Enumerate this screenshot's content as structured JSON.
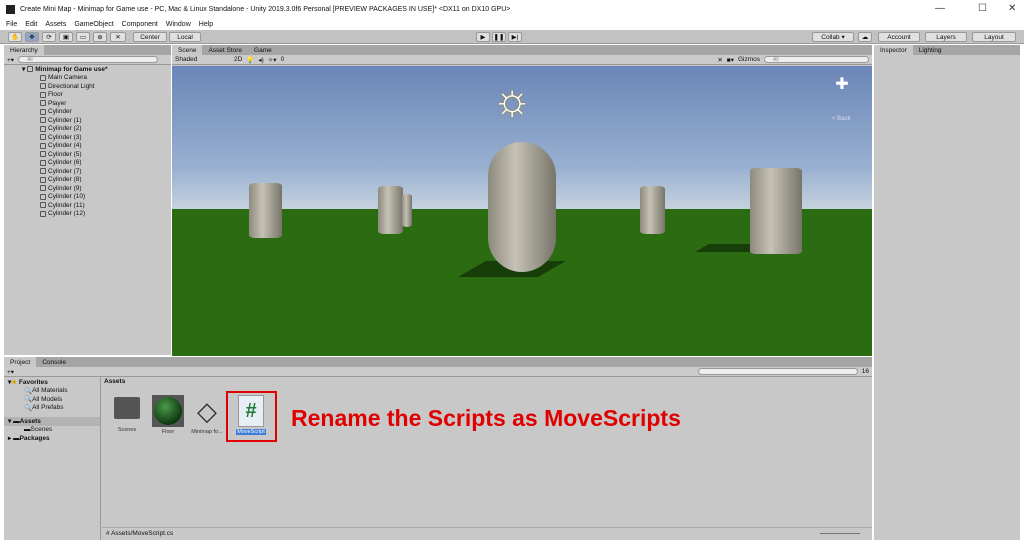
{
  "window": {
    "title": "Create Mini Map - Minimap for Game use - PC, Mac & Linux Standalone - Unity 2019.3.0f6 Personal [PREVIEW PACKAGES IN USE]* <DX11 on DX10 GPU>"
  },
  "menu": [
    "File",
    "Edit",
    "Assets",
    "GameObject",
    "Component",
    "Window",
    "Help"
  ],
  "toolbar": {
    "center": "Center",
    "local": "Local",
    "collab": "Collab ▾",
    "account": "Account",
    "layers": "Layers",
    "layout": "Layout"
  },
  "hierarchy": {
    "tab": "Hierarchy",
    "search": "All",
    "scene": "Minimap for Game use*",
    "items": [
      "Main Camera",
      "Directional Light",
      "Floor",
      "Player",
      "Cylinder",
      "Cylinder (1)",
      "Cylinder (2)",
      "Cylinder (3)",
      "Cylinder (4)",
      "Cylinder (5)",
      "Cylinder (6)",
      "Cylinder (7)",
      "Cylinder (8)",
      "Cylinder (9)",
      "Cylinder (10)",
      "Cylinder (11)",
      "Cylinder (12)"
    ]
  },
  "scene_view": {
    "tabs": [
      "Scene",
      "Asset Store",
      "Game"
    ],
    "shading": "Shaded",
    "mode": "2D",
    "gizmos": "Gizmos",
    "search": "All",
    "hidden_count": "0",
    "back_label": "< Back"
  },
  "inspector": {
    "tabs": [
      "Inspector",
      "Lighting"
    ]
  },
  "project": {
    "tabs": [
      "Project",
      "Console"
    ],
    "favorites": "Favorites",
    "fav_items": [
      "All Materials",
      "All Models",
      "All Prefabs"
    ],
    "assets": "Assets",
    "asset_children": [
      "Scenes"
    ],
    "packages": "Packages",
    "breadcrumb": "Assets",
    "count": "16",
    "items": [
      "Scenes",
      "Floor",
      "Minimap fo...",
      "MoveScript"
    ],
    "status_path": "Assets/MoveScript.cs"
  },
  "annotation": {
    "text": "Rename the Scripts as MoveScripts",
    "color": "#e00000"
  }
}
